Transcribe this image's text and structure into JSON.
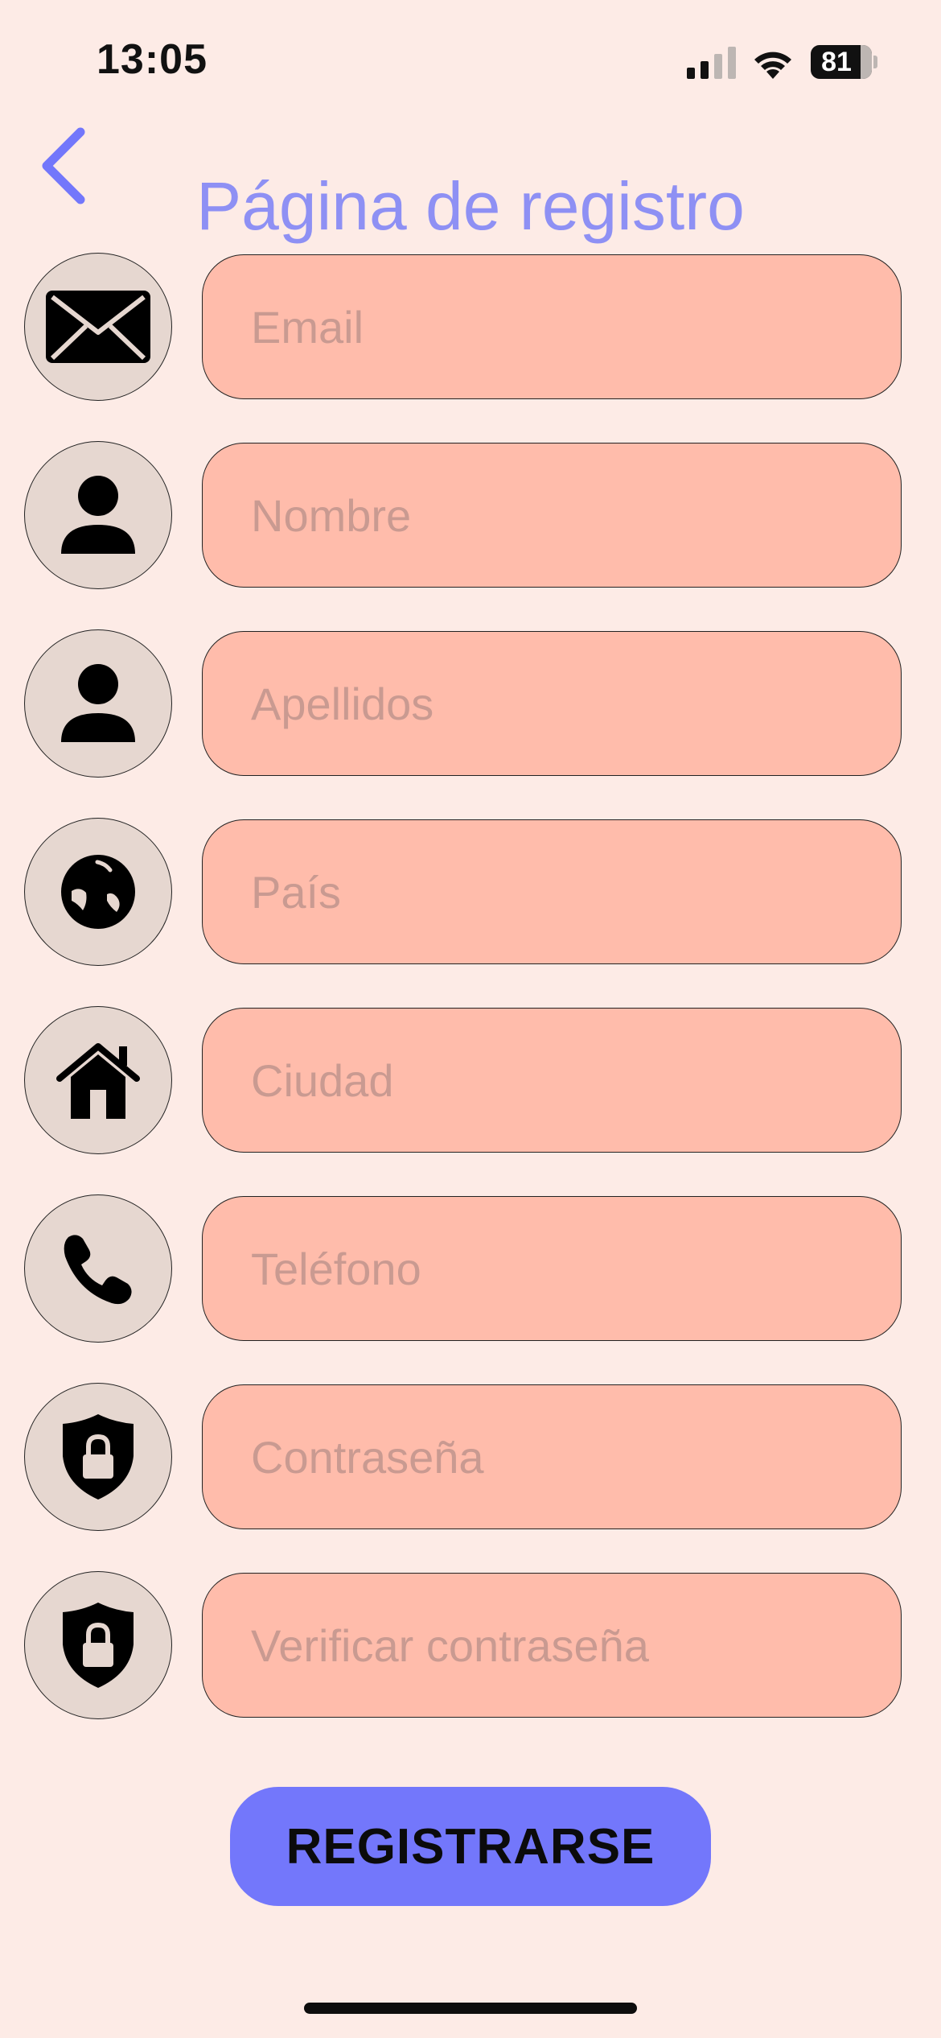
{
  "status_bar": {
    "time": "13:05",
    "battery_level": "81",
    "signal_icon": "cellular-signal-icon",
    "wifi_icon": "wifi-icon"
  },
  "header": {
    "back_icon": "chevron-left-icon",
    "title": "Página de registro"
  },
  "form": {
    "fields": [
      {
        "icon": "envelope-icon",
        "placeholder": "Email"
      },
      {
        "icon": "person-icon",
        "placeholder": "Nombre"
      },
      {
        "icon": "person-icon",
        "placeholder": "Apellidos"
      },
      {
        "icon": "globe-icon",
        "placeholder": "País"
      },
      {
        "icon": "house-icon",
        "placeholder": "Ciudad"
      },
      {
        "icon": "phone-icon",
        "placeholder": "Teléfono"
      },
      {
        "icon": "lock-shield-icon",
        "placeholder": "Contraseña"
      },
      {
        "icon": "lock-shield-icon",
        "placeholder": "Verificar contraseña"
      }
    ],
    "submit_label": "REGISTRARSE"
  },
  "colors": {
    "background": "#FDEBE6",
    "title": "#8E90F4",
    "field_fill": "#FFBCAB",
    "icon_circle_fill": "#E6D7D0",
    "button": "#7377FB"
  }
}
